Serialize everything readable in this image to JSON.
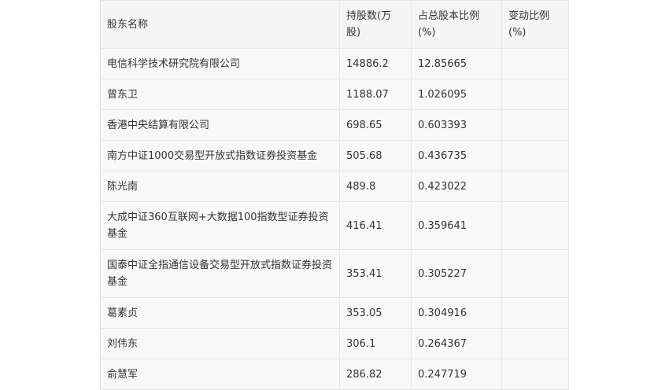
{
  "table": {
    "headers": [
      "股东名称",
      "持股数(万股)",
      "占总股本比例(%)",
      "变动比例(%)"
    ],
    "rows": [
      {
        "name": "电信科学技术研究院有限公司",
        "shares": "14886.2",
        "ratio": "12.85665",
        "change": ""
      },
      {
        "name": "曾东卫",
        "shares": "1188.07",
        "ratio": "1.026095",
        "change": ""
      },
      {
        "name": "香港中央结算有限公司",
        "shares": "698.65",
        "ratio": "0.603393",
        "change": ""
      },
      {
        "name": "南方中证1000交易型开放式指数证券投资基金",
        "shares": "505.68",
        "ratio": "0.436735",
        "change": ""
      },
      {
        "name": "陈光南",
        "shares": "489.8",
        "ratio": "0.423022",
        "change": ""
      },
      {
        "name": "大成中证360互联网+大数据100指数型证券投资基金",
        "shares": "416.41",
        "ratio": "0.359641",
        "change": ""
      },
      {
        "name": "国泰中证全指通信设备交易型开放式指数证券投资基金",
        "shares": "353.41",
        "ratio": "0.305227",
        "change": ""
      },
      {
        "name": "葛素贞",
        "shares": "353.05",
        "ratio": "0.304916",
        "change": ""
      },
      {
        "name": "刘伟东",
        "shares": "306.1",
        "ratio": "0.264367",
        "change": ""
      },
      {
        "name": "俞慧军",
        "shares": "286.82",
        "ratio": "0.247719",
        "change": ""
      }
    ]
  }
}
